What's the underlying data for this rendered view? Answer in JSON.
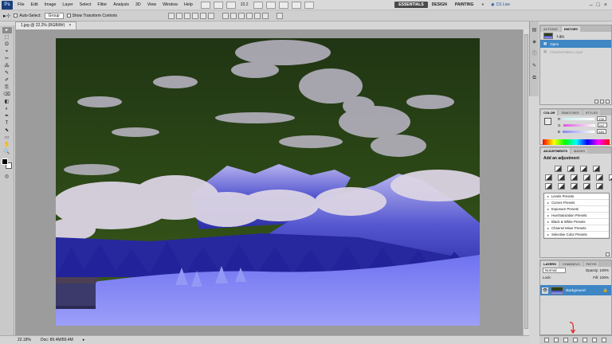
{
  "app": {
    "logo": "Ps"
  },
  "menu": [
    "File",
    "Edit",
    "Image",
    "Layer",
    "Select",
    "Filter",
    "Analysis",
    "3D",
    "View",
    "Window",
    "Help"
  ],
  "top_bar": {
    "zoom": "22.2",
    "workspaces": [
      "ESSENTIALS",
      "DESIGN",
      "PAINTING"
    ],
    "more": "»",
    "cs_live": "CS Live"
  },
  "options": {
    "auto_select_label": "Auto-Select:",
    "auto_select_value": "Group",
    "transform_label": "Show Transform Controls"
  },
  "document": {
    "tab_title": "1.jpg @ 22.2% (RGB/8#)",
    "close": "×"
  },
  "status": {
    "zoom": "22.18%",
    "doc_info": "Doc: 89.4M/89.4M"
  },
  "tools": [
    "▸",
    "⬚",
    "ʘ",
    "⌖",
    "✂",
    "⁂",
    "✎",
    "✐",
    "⎘",
    "⌫",
    "◧",
    "◐",
    "✒",
    "T",
    "⬉",
    "▭",
    "✋",
    "🔍"
  ],
  "history": {
    "tabs": [
      "ACTIONS",
      "HISTORY"
    ],
    "snapshot": "1.jpg",
    "items": [
      {
        "label": "Open",
        "state": "selected"
      },
      {
        "label": "Channel Mixer Layer",
        "state": "dim"
      }
    ]
  },
  "color_panel": {
    "tabs": [
      "COLOR",
      "SWATCHES",
      "STYLES"
    ],
    "channels": [
      {
        "label": "R",
        "value": "239",
        "gradient": "#c9f0f0,#ffffff"
      },
      {
        "label": "G",
        "value": "247",
        "gradient": "#dd55dd,#ffffff"
      },
      {
        "label": "B",
        "value": "248",
        "gradient": "#8888ee,#ffffff"
      }
    ]
  },
  "adjustments": {
    "tabs": [
      "ADJUSTMENTS",
      "MASKS"
    ],
    "title": "Add an adjustment",
    "presets": [
      "Levels Presets",
      "Curves Presets",
      "Exposure Presets",
      "Hue/Saturation Presets",
      "Black & White Presets",
      "Channel Mixer Presets",
      "Selective Color Presets"
    ]
  },
  "layers": {
    "tabs": [
      "LAYERS",
      "CHANNELS",
      "PATHS"
    ],
    "blend_mode": "Normal",
    "opacity_label": "Opacity:",
    "opacity": "100%",
    "lock_label": "Lock:",
    "fill_label": "Fill:",
    "fill": "100%",
    "items": [
      {
        "name": "Background",
        "selected": true
      }
    ]
  },
  "colors": {
    "selection": "#3f86c5",
    "annotation": "#e02020"
  }
}
